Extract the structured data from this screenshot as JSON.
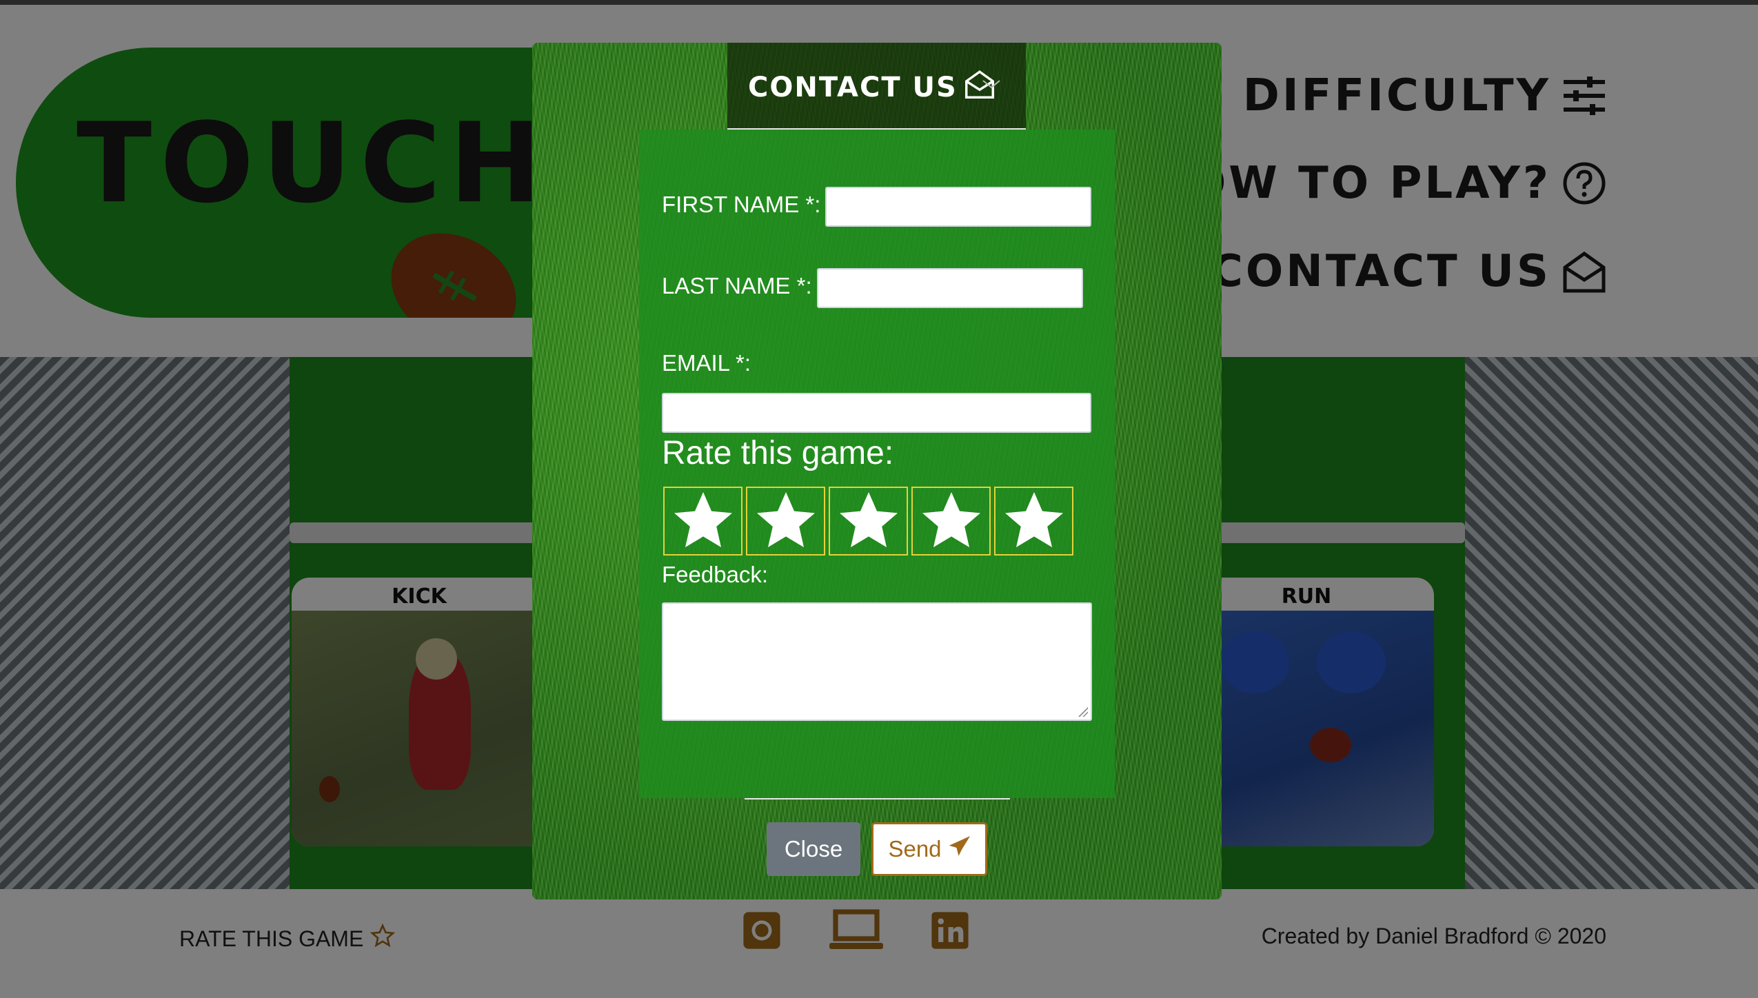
{
  "header": {
    "logo_text": "TOUCHD",
    "nav": [
      {
        "label": "DIFFICULTY",
        "icon": "sliders-icon"
      },
      {
        "label": "HOW TO PLAY?",
        "icon": "question-circle-icon"
      },
      {
        "label": "CONTACT US",
        "icon": "envelope-open-icon"
      }
    ]
  },
  "cards": [
    {
      "title": "KICK"
    },
    {
      "title": "RUN"
    }
  ],
  "footer": {
    "rate_label": "RATE THIS GAME",
    "social": [
      "github-icon",
      "laptop-icon",
      "linkedin-icon"
    ],
    "credit": "Created by Daniel Bradford © 2020"
  },
  "modal": {
    "title": "CONTACT US",
    "first_name_label": "FIRST NAME *:",
    "first_name_value": "",
    "last_name_label": "LAST NAME *:",
    "last_name_value": "",
    "email_label": "EMAIL *:",
    "email_value": "",
    "rate_title": "Rate this game:",
    "stars": [
      1,
      2,
      3,
      4,
      5
    ],
    "feedback_label": "Feedback:",
    "feedback_value": "",
    "close_label": "Close",
    "send_label": "Send"
  },
  "colors": {
    "accent_brown": "#a06a1a",
    "logo_green": "#1f9920",
    "overlay": "rgba(0,0,0,0.5)"
  }
}
